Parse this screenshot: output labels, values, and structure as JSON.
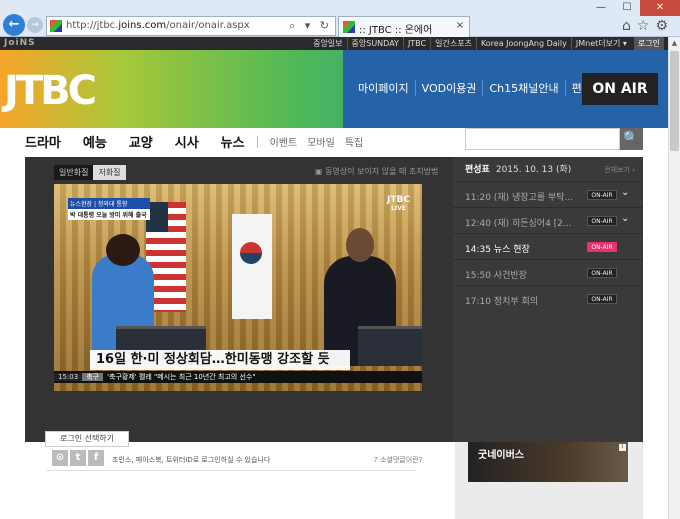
{
  "browser": {
    "url_prefix": "http://jtbc.",
    "url_domain": "joins.com",
    "url_path": "/onair/onair.aspx",
    "addr_controls": "⌕ ▾ ↻",
    "tab_title": ":: JTBC :: 온에어",
    "tab_close": "×",
    "win_min": "—",
    "win_max": "☐",
    "win_close": "✕",
    "back": "←",
    "fwd": "→",
    "tools": "⌂☆⚙"
  },
  "topbar": {
    "brand": "JoiNS",
    "links": [
      "중앙일보",
      "중앙SUNDAY",
      "JTBC",
      "일간스포츠",
      "Korea JoongAng Daily",
      "JMnet더보기 ▾"
    ],
    "login": "로그인"
  },
  "banner": {
    "logo": "JTBC",
    "menu": [
      "마이페이지",
      "VOD이용권",
      "Ch15채널안내",
      "편성표"
    ],
    "onair": "ON AIR"
  },
  "nav": {
    "main": [
      "드라마",
      "예능",
      "교양",
      "시사",
      "뉴스"
    ],
    "sub": [
      "이벤트",
      "모바일",
      "특집"
    ],
    "search_icon": "🔍"
  },
  "player": {
    "tabs": [
      "일반화질",
      "저화질"
    ],
    "help": "▣ 동영상이 보이지 않을 때 조치방법",
    "news_tag_top": "뉴스현장 | 청와대 통향",
    "news_tag_bottom": "박 대통령 오늘 방미 위해 출국",
    "live_logo": "JTBC",
    "live_label": "LIVE",
    "caption": "16일 한·미 정상회담…한미동맹 강조할 듯",
    "ticker_time": "15:03",
    "ticker_cat": "축구",
    "ticker_text": "'축구황제' 펠레 \"메시는 최근 10년간 최고의 선수\""
  },
  "schedule": {
    "title": "편성표",
    "date": "2015. 10. 13 (화)",
    "all_link": "전체보기 ›",
    "items": [
      {
        "time": "11:20  (재) 냉장고를 부탁...",
        "badge": "ON-AIR",
        "chevron": "⌄"
      },
      {
        "time": "12:40  (재) 히든싱어4 [2...",
        "badge": "ON-AIR",
        "chevron": "⌄"
      },
      {
        "time": "14:35  뉴스 현장",
        "badge": "ON-AIR",
        "chevron": ""
      },
      {
        "time": "15:50  사건반장",
        "badge": "ON-AIR",
        "chevron": ""
      },
      {
        "time": "17:10  정치부 회의",
        "badge": "ON-AIR",
        "chevron": ""
      }
    ]
  },
  "comments": {
    "login_tip": "로그인 선택하기",
    "social_text": "조인스, 페이스북, 트위터ID로 로그인하실 수 있습니다",
    "rules": "? 소셜댓글이란?",
    "social_icons": [
      "⊙",
      "t",
      "f"
    ]
  },
  "ad": {
    "text": "굿네이버스",
    "info": "i"
  }
}
